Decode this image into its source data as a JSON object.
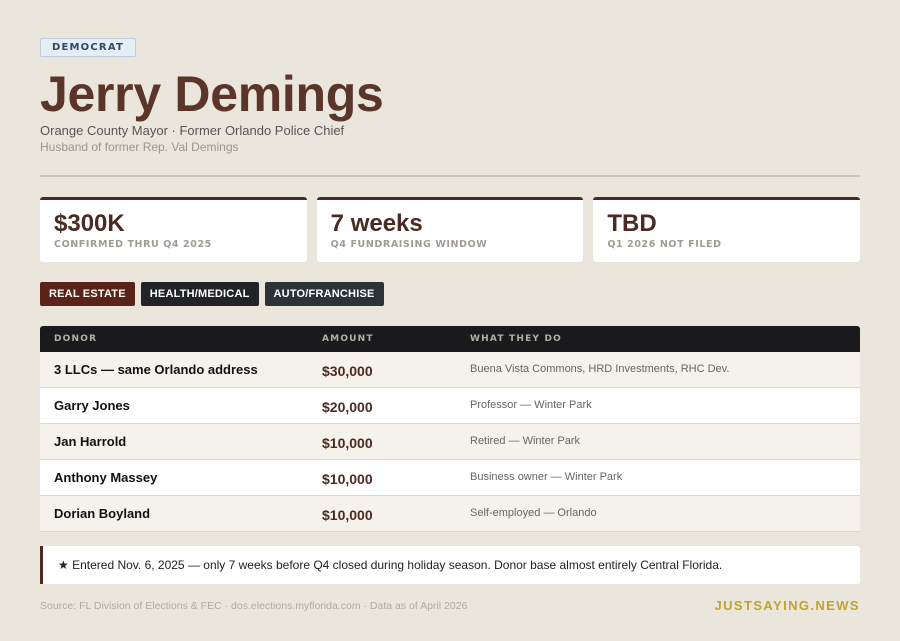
{
  "header": {
    "party": "DEMOCRAT",
    "name": "Jerry Demings",
    "subtitle": "Orange County Mayor · Former Orlando Police Chief",
    "subtitle2": "Husband of former Rep. Val Demings"
  },
  "stats": [
    {
      "value": "$300K",
      "label": "CONFIRMED THRU Q4 2025"
    },
    {
      "value": "7 weeks",
      "label": "Q4 FUNDRAISING WINDOW"
    },
    {
      "value": "TBD",
      "label": "Q1 2026 NOT FILED"
    }
  ],
  "tags": [
    {
      "label": "REAL ESTATE",
      "color": "#5b2318"
    },
    {
      "label": "HEALTH/MEDICAL",
      "color": "#222326"
    },
    {
      "label": "AUTO/FRANCHISE",
      "color": "#2c3338"
    }
  ],
  "table": {
    "headers": [
      "DONOR",
      "AMOUNT",
      "WHAT THEY DO"
    ],
    "rows": [
      {
        "donor": "3 LLCs — same Orlando address",
        "amount": "$30,000",
        "what": "Buena Vista Commons, HRD Investments, RHC Dev."
      },
      {
        "donor": "Garry Jones",
        "amount": "$20,000",
        "what": "Professor — Winter Park"
      },
      {
        "donor": "Jan Harrold",
        "amount": "$10,000",
        "what": "Retired — Winter Park"
      },
      {
        "donor": "Anthony Massey",
        "amount": "$10,000",
        "what": "Business owner — Winter Park"
      },
      {
        "donor": "Dorian Boyland",
        "amount": "$10,000",
        "what": "Self-employed — Orlando"
      }
    ]
  },
  "note": "★ Entered Nov. 6, 2025 — only 7 weeks before Q4 closed during holiday season. Donor base almost entirely Central Florida.",
  "footer": {
    "source": "Source: FL Division of Elections & FEC · dos.elections.myflorida.com · Data as of April 2026",
    "brand": "JUSTSAYING.NEWS"
  },
  "colors": {
    "background": "#ebe6dc",
    "accent": "#5b342a",
    "brand": "#c2a22a"
  }
}
